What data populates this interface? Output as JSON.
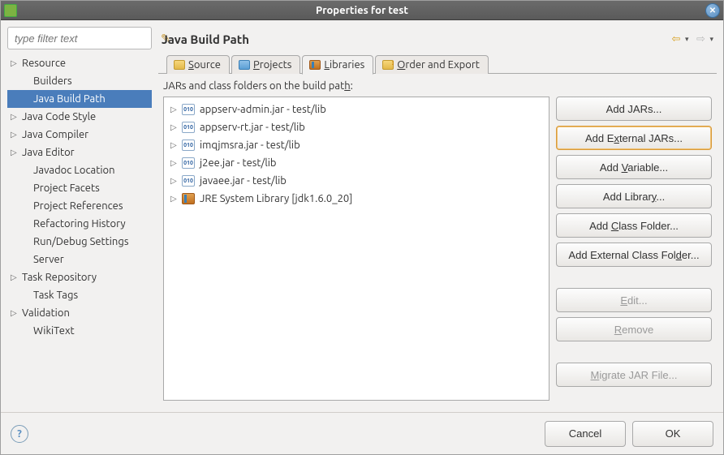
{
  "window": {
    "title": "Properties for test"
  },
  "sidebar": {
    "filter_placeholder": "type filter text",
    "items": [
      {
        "label": "Resource",
        "expandable": true,
        "indent": 0
      },
      {
        "label": "Builders",
        "expandable": false,
        "indent": 1
      },
      {
        "label": "Java Build Path",
        "expandable": false,
        "indent": 1,
        "selected": true
      },
      {
        "label": "Java Code Style",
        "expandable": true,
        "indent": 0
      },
      {
        "label": "Java Compiler",
        "expandable": true,
        "indent": 0
      },
      {
        "label": "Java Editor",
        "expandable": true,
        "indent": 0
      },
      {
        "label": "Javadoc Location",
        "expandable": false,
        "indent": 1
      },
      {
        "label": "Project Facets",
        "expandable": false,
        "indent": 1
      },
      {
        "label": "Project References",
        "expandable": false,
        "indent": 1
      },
      {
        "label": "Refactoring History",
        "expandable": false,
        "indent": 1
      },
      {
        "label": "Run/Debug Settings",
        "expandable": false,
        "indent": 1
      },
      {
        "label": "Server",
        "expandable": false,
        "indent": 1
      },
      {
        "label": "Task Repository",
        "expandable": true,
        "indent": 0
      },
      {
        "label": "Task Tags",
        "expandable": false,
        "indent": 1
      },
      {
        "label": "Validation",
        "expandable": true,
        "indent": 0
      },
      {
        "label": "WikiText",
        "expandable": false,
        "indent": 1
      }
    ]
  },
  "main": {
    "title": "Java Build Path",
    "tabs": [
      {
        "label": "Source",
        "icon": "folder"
      },
      {
        "label": "Projects",
        "icon": "proj"
      },
      {
        "label": "Libraries",
        "icon": "lib",
        "active": true
      },
      {
        "label": "Order and Export",
        "icon": "order"
      }
    ],
    "section_label_pre": "JARs and class folders on the build pat",
    "section_label_u": "h",
    "section_label_post": ":",
    "jars": [
      {
        "label": "appserv-admin.jar - test/lib",
        "type": "jar"
      },
      {
        "label": "appserv-rt.jar - test/lib",
        "type": "jar"
      },
      {
        "label": "imqjmsra.jar - test/lib",
        "type": "jar"
      },
      {
        "label": "j2ee.jar - test/lib",
        "type": "jar"
      },
      {
        "label": "javaee.jar - test/lib",
        "type": "jar"
      },
      {
        "label": "JRE System Library [jdk1.6.0_20]",
        "type": "jre"
      }
    ],
    "buttons": {
      "add_jars": "Add JARs...",
      "add_external_jars_pre": "Add E",
      "add_external_jars_u": "x",
      "add_external_jars_post": "ternal JARs...",
      "add_variable_pre": "Add ",
      "add_variable_u": "V",
      "add_variable_post": "ariable...",
      "add_library_pre": "Add Librar",
      "add_library_u": "y",
      "add_library_post": "...",
      "add_class_folder_pre": "Add ",
      "add_class_folder_u": "C",
      "add_class_folder_post": "lass Folder...",
      "add_ext_class_folder_pre": "Add External Class Fol",
      "add_ext_class_folder_u": "d",
      "add_ext_class_folder_post": "er...",
      "edit_pre": "",
      "edit_u": "E",
      "edit_post": "dit...",
      "remove_pre": "",
      "remove_u": "R",
      "remove_post": "emove",
      "migrate_pre": "",
      "migrate_u": "M",
      "migrate_post": "igrate JAR File..."
    }
  },
  "footer": {
    "cancel": "Cancel",
    "ok": "OK"
  }
}
